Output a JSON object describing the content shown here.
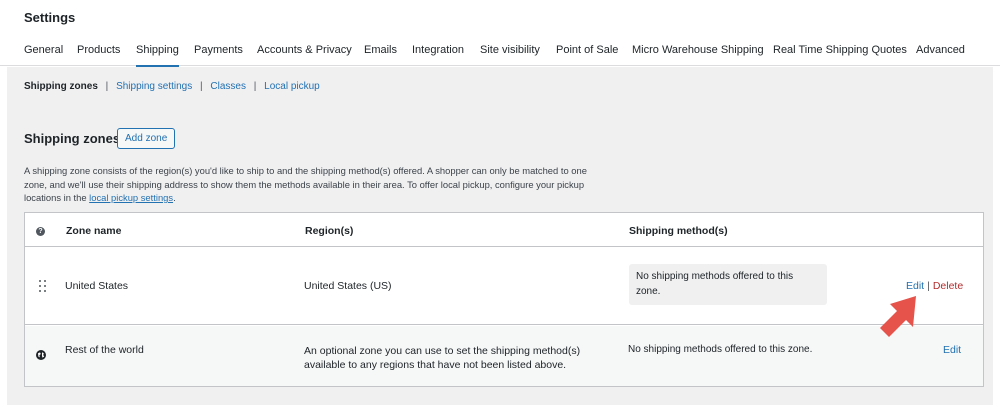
{
  "page": {
    "title": "Settings"
  },
  "tabs": [
    {
      "label": "General"
    },
    {
      "label": "Products"
    },
    {
      "label": "Shipping",
      "active": true
    },
    {
      "label": "Payments"
    },
    {
      "label": "Accounts & Privacy"
    },
    {
      "label": "Emails"
    },
    {
      "label": "Integration"
    },
    {
      "label": "Site visibility"
    },
    {
      "label": "Point of Sale"
    },
    {
      "label": "Micro Warehouse Shipping"
    },
    {
      "label": "Real Time Shipping Quotes"
    },
    {
      "label": "Advanced"
    }
  ],
  "subnav": {
    "current": "Shipping zones",
    "links": [
      "Shipping settings",
      "Classes",
      "Local pickup"
    ],
    "separator": "|"
  },
  "zones": {
    "title": "Shipping zones",
    "add_button": "Add zone",
    "description": "A shipping zone consists of the region(s) you'd like to ship to and the shipping method(s) offered. A shopper can only be matched to one zone, and we'll use their shipping address to show them the methods available in their area. To offer local pickup, configure your pickup locations in the",
    "description_link": "local pickup settings",
    "description_end": "."
  },
  "table": {
    "headers": {
      "zone_name": "Zone name",
      "regions": "Region(s)",
      "methods": "Shipping method(s)"
    },
    "rows": [
      {
        "zone_name": "United States",
        "region": "United States (US)",
        "methods": "No shipping methods offered to this zone.",
        "edit": "Edit",
        "separator": "|",
        "delete": "Delete"
      },
      {
        "zone_name": "Rest of the world",
        "region": "An optional zone you can use to set the shipping method(s) available to any regions that have not been listed above.",
        "methods": "No shipping methods offered to this zone.",
        "edit": "Edit"
      }
    ]
  },
  "colors": {
    "accent": "#2271b1",
    "delete": "#b32d2e",
    "arrow": "#e5534b",
    "panel_bg": "#f0f0f1"
  },
  "icons": {
    "help": "help-circle-icon",
    "drag": "drag-handle-icon",
    "globe": "globe-icon",
    "arrow": "pointer-arrow-icon"
  }
}
